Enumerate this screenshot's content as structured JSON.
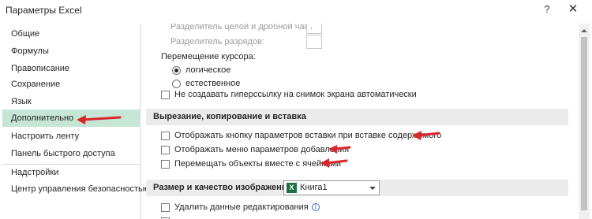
{
  "window": {
    "title": "Параметры Excel",
    "help_label": "?",
    "close_label": "✕"
  },
  "nav": {
    "items": [
      {
        "label": "Общие"
      },
      {
        "label": "Формулы"
      },
      {
        "label": "Правописание"
      },
      {
        "label": "Сохранение"
      },
      {
        "label": "Язык"
      },
      {
        "label": "Дополнительно",
        "selected": true
      },
      {
        "label": "Настроить ленту"
      },
      {
        "label": "Панель быстрого доступа"
      },
      {
        "label": "Надстройки"
      },
      {
        "label": "Центр управления безопасностью"
      }
    ]
  },
  "content": {
    "decimal_separator_label": "Разделитель целой и дробной части:",
    "decimal_separator_value": ",",
    "thousands_separator_label": "Разделитель разрядов:",
    "cursor_movement_label": "Перемещение курсора:",
    "cursor_options": [
      {
        "label": "логическое",
        "checked": true
      },
      {
        "label": "естественное",
        "checked": false
      }
    ],
    "no_hyperlink_label": "Не создавать гиперссылку на снимок экрана автоматически",
    "cut_copy_section": {
      "title": "Вырезание, копирование и вставка",
      "options": [
        {
          "label": "Отображать кнопку параметров вставки при вставке содержимого",
          "checked": false
        },
        {
          "label": "Отображать меню параметров добавления",
          "checked": false
        },
        {
          "label": "Перемещать объекты вместе с ячейками",
          "checked": false
        }
      ]
    },
    "image_section": {
      "title": "Размер и качество изображения",
      "workbook_value": "Книга1",
      "workbook_icon": "X",
      "discard_editing_label": "Удалить данные редактирования",
      "info_icon": "i"
    }
  },
  "colors": {
    "selected_nav": "#c5e5d5",
    "section_bg": "#ebebeb",
    "arrow": "#d9262b",
    "excel_green": "#1d7044"
  }
}
